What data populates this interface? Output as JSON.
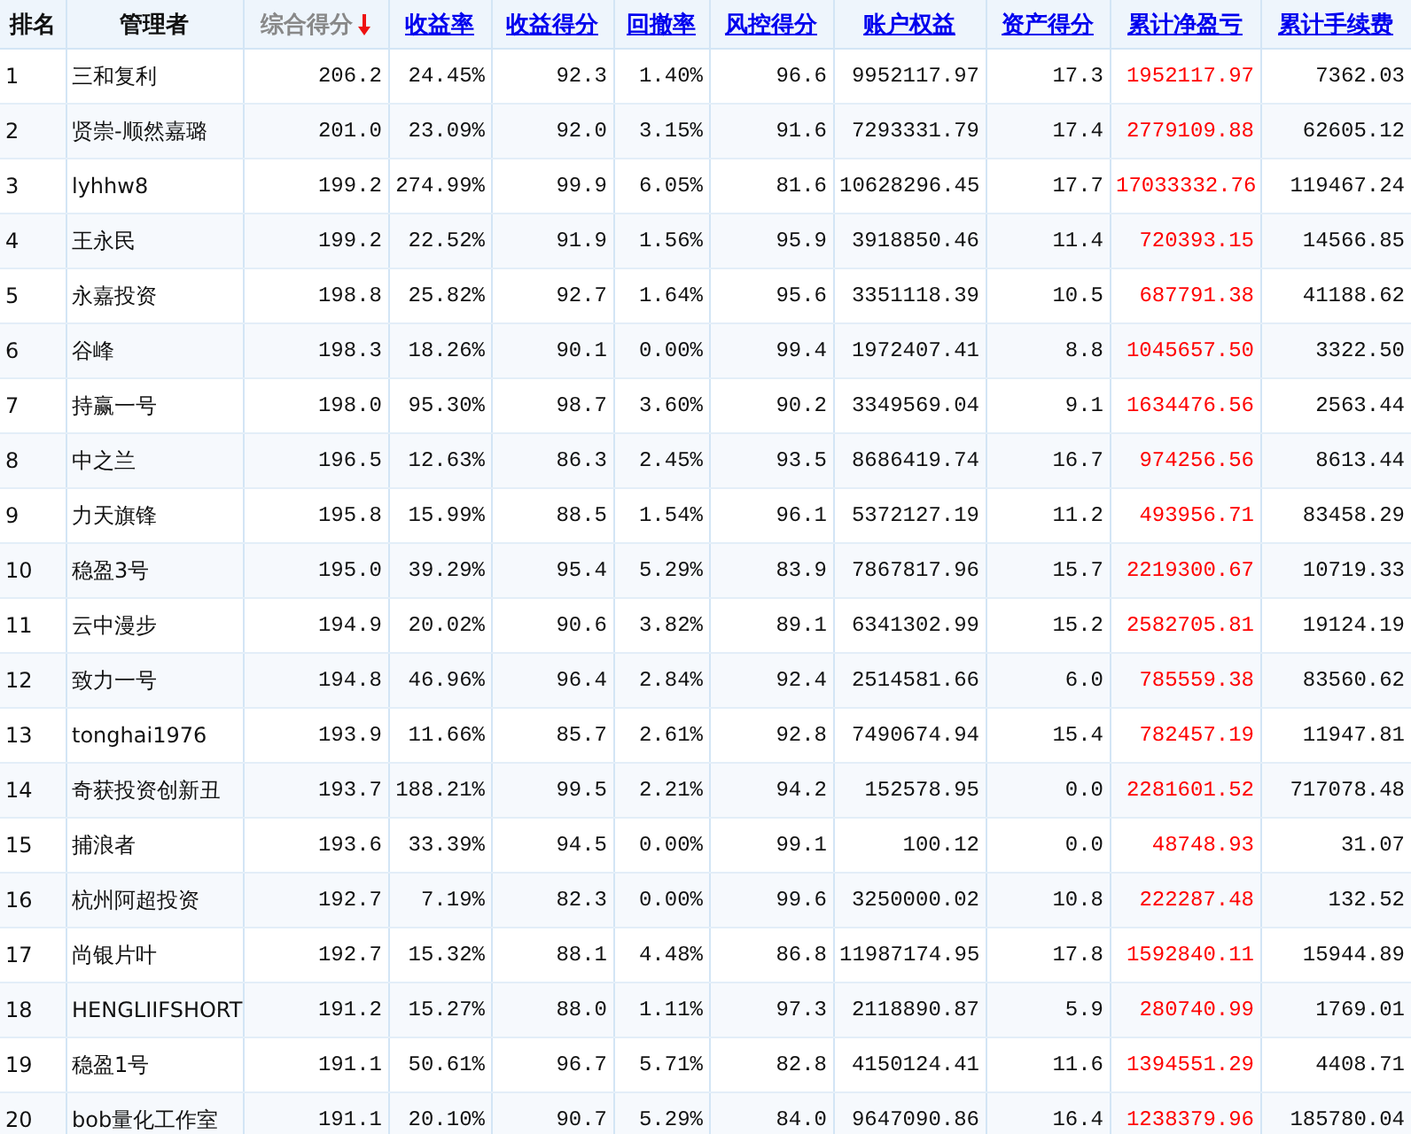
{
  "table": {
    "columns": [
      {
        "label": "排名",
        "kind": "plain"
      },
      {
        "label": "管理者",
        "kind": "plain"
      },
      {
        "label": "综合得分",
        "kind": "sorted"
      },
      {
        "label": "收益率",
        "kind": "link"
      },
      {
        "label": "收益得分",
        "kind": "link"
      },
      {
        "label": "回撤率",
        "kind": "link"
      },
      {
        "label": "风控得分",
        "kind": "link"
      },
      {
        "label": "账户权益",
        "kind": "link"
      },
      {
        "label": "资产得分",
        "kind": "link"
      },
      {
        "label": "累计净盈亏",
        "kind": "link",
        "color": "#ff0000"
      },
      {
        "label": "累计手续费",
        "kind": "link"
      }
    ],
    "rows": [
      [
        "1",
        "三和复利",
        "206.2",
        "24.45%",
        "92.3",
        "1.40%",
        "96.6",
        "9952117.97",
        "17.3",
        "1952117.97",
        "7362.03"
      ],
      [
        "2",
        "贤崇-顺然嘉璐",
        "201.0",
        "23.09%",
        "92.0",
        "3.15%",
        "91.6",
        "7293331.79",
        "17.4",
        "2779109.88",
        "62605.12"
      ],
      [
        "3",
        "lyhhw8",
        "199.2",
        "274.99%",
        "99.9",
        "6.05%",
        "81.6",
        "10628296.45",
        "17.7",
        "17033332.76",
        "119467.24"
      ],
      [
        "4",
        "王永民",
        "199.2",
        "22.52%",
        "91.9",
        "1.56%",
        "95.9",
        "3918850.46",
        "11.4",
        "720393.15",
        "14566.85"
      ],
      [
        "5",
        "永嘉投资",
        "198.8",
        "25.82%",
        "92.7",
        "1.64%",
        "95.6",
        "3351118.39",
        "10.5",
        "687791.38",
        "41188.62"
      ],
      [
        "6",
        "谷峰",
        "198.3",
        "18.26%",
        "90.1",
        "0.00%",
        "99.4",
        "1972407.41",
        "8.8",
        "1045657.50",
        "3322.50"
      ],
      [
        "7",
        "持赢一号",
        "198.0",
        "95.30%",
        "98.7",
        "3.60%",
        "90.2",
        "3349569.04",
        "9.1",
        "1634476.56",
        "2563.44"
      ],
      [
        "8",
        "中之兰",
        "196.5",
        "12.63%",
        "86.3",
        "2.45%",
        "93.5",
        "8686419.74",
        "16.7",
        "974256.56",
        "8613.44"
      ],
      [
        "9",
        "力天旗锋",
        "195.8",
        "15.99%",
        "88.5",
        "1.54%",
        "96.1",
        "5372127.19",
        "11.2",
        "493956.71",
        "83458.29"
      ],
      [
        "10",
        "稳盈3号",
        "195.0",
        "39.29%",
        "95.4",
        "5.29%",
        "83.9",
        "7867817.96",
        "15.7",
        "2219300.67",
        "10719.33"
      ],
      [
        "11",
        "云中漫步",
        "194.9",
        "20.02%",
        "90.6",
        "3.82%",
        "89.1",
        "6341302.99",
        "15.2",
        "2582705.81",
        "19124.19"
      ],
      [
        "12",
        "致力一号",
        "194.8",
        "46.96%",
        "96.4",
        "2.84%",
        "92.4",
        "2514581.66",
        "6.0",
        "785559.38",
        "83560.62"
      ],
      [
        "13",
        "tonghai1976",
        "193.9",
        "11.66%",
        "85.7",
        "2.61%",
        "92.8",
        "7490674.94",
        "15.4",
        "782457.19",
        "11947.81"
      ],
      [
        "14",
        "奇获投资创新丑",
        "193.7",
        "188.21%",
        "99.5",
        "2.21%",
        "94.2",
        "152578.95",
        "0.0",
        "2281601.52",
        "717078.48"
      ],
      [
        "15",
        "捕浪者",
        "193.6",
        "33.39%",
        "94.5",
        "0.00%",
        "99.1",
        "100.12",
        "0.0",
        "48748.93",
        "31.07"
      ],
      [
        "16",
        "杭州阿超投资",
        "192.7",
        "7.19%",
        "82.3",
        "0.00%",
        "99.6",
        "3250000.02",
        "10.8",
        "222287.48",
        "132.52"
      ],
      [
        "17",
        "尚银片叶",
        "192.7",
        "15.32%",
        "88.1",
        "4.48%",
        "86.8",
        "11987174.95",
        "17.8",
        "1592840.11",
        "15944.89"
      ],
      [
        "18",
        "HENGLIIFSHORT",
        "191.2",
        "15.27%",
        "88.0",
        "1.11%",
        "97.3",
        "2118890.87",
        "5.9",
        "280740.99",
        "1769.01"
      ],
      [
        "19",
        "稳盈1号",
        "191.1",
        "50.61%",
        "96.7",
        "5.71%",
        "82.8",
        "4150124.41",
        "11.6",
        "1394551.29",
        "4408.71"
      ],
      [
        "20",
        "bob量化工作室",
        "191.1",
        "20.10%",
        "90.7",
        "5.29%",
        "84.0",
        "9647090.86",
        "16.4",
        "1238379.96",
        "185780.04"
      ]
    ]
  }
}
